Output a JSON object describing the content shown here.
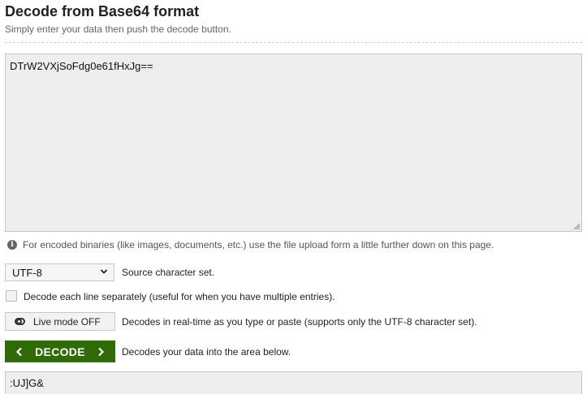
{
  "header": {
    "title": "Decode from Base64 format",
    "subtitle": "Simply enter your data then push the decode button."
  },
  "input": {
    "value": "DTrW2VXjSoFdg0e61fHxJg=="
  },
  "info": {
    "icon": "info-icon",
    "text": "For encoded binaries (like images, documents, etc.) use the file upload form a little further down on this page."
  },
  "charset": {
    "selected": "UTF-8",
    "label": "Source character set."
  },
  "line_option": {
    "checked": false,
    "label": "Decode each line separately (useful for when you have multiple entries)."
  },
  "live_mode": {
    "button_label": "Live mode OFF",
    "description": "Decodes in real-time as you type or paste (supports only the UTF-8 character set)."
  },
  "decode": {
    "button_label": "DECODE",
    "description": "Decodes your data into the area below."
  },
  "output": {
    "value": ":UJ]G&"
  },
  "colors": {
    "decode_button": "#2f6b06",
    "textarea_bg": "#eeeeee"
  }
}
